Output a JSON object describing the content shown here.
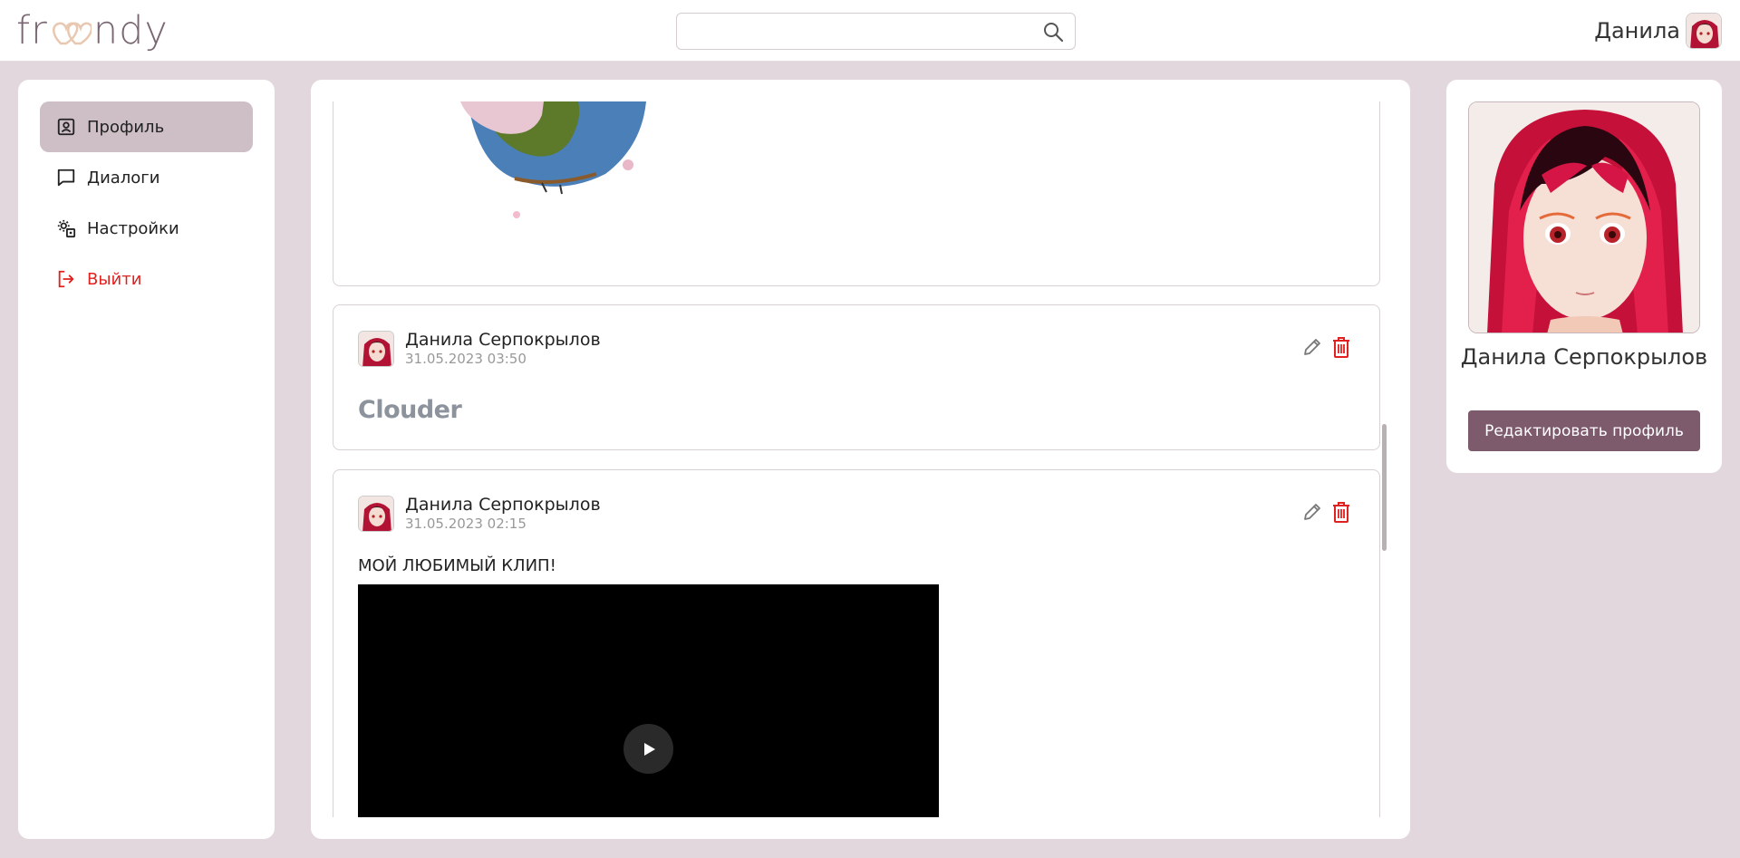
{
  "app": {
    "logo_text_left": "fr",
    "logo_text_right": "ndy"
  },
  "header": {
    "search_placeholder": "",
    "user_name": "Данила"
  },
  "sidebar": {
    "items": [
      {
        "label": "Профиль",
        "icon": "profile-icon",
        "active": true
      },
      {
        "label": "Диалоги",
        "icon": "chat-icon",
        "active": false
      },
      {
        "label": "Настройки",
        "icon": "settings-icon",
        "active": false
      },
      {
        "label": "Выйти",
        "icon": "logout-icon",
        "active": false
      }
    ]
  },
  "feed": {
    "posts": [
      {
        "kind": "image"
      },
      {
        "author": "Данила Серпокрылов",
        "date": "31.05.2023 03:50",
        "logo_text": "Clouder"
      },
      {
        "author": "Данила Серпокрылов",
        "date": "31.05.2023 02:15",
        "text": "МОЙ ЛЮБИМЫЙ КЛИП!"
      }
    ]
  },
  "profile": {
    "name": "Данила Серпокрылов",
    "edit_button": "Редактировать профиль"
  },
  "colors": {
    "background": "#e2d7dc",
    "accent": "#7d5a6c",
    "active_nav": "#cdbfc5",
    "logout": "#e0211f",
    "delete": "#e0211f"
  }
}
